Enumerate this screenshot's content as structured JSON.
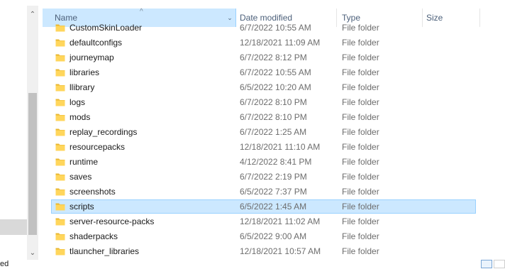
{
  "columns": {
    "name": "Name",
    "date_modified": "Date modified",
    "type": "Type",
    "size": "Size",
    "sort_indicator": "^",
    "name_dropdown": "⌄"
  },
  "nav": {
    "partial_text": "ed"
  },
  "scrollbar": {
    "up": "⌃",
    "down": "⌄"
  },
  "files": [
    {
      "name": "CustomSkinLoader",
      "date": "6/7/2022 10:55 AM",
      "type": "File folder"
    },
    {
      "name": "defaultconfigs",
      "date": "12/18/2021 11:09 AM",
      "type": "File folder"
    },
    {
      "name": "journeymap",
      "date": "6/7/2022 8:12 PM",
      "type": "File folder"
    },
    {
      "name": "libraries",
      "date": "6/7/2022 10:55 AM",
      "type": "File folder"
    },
    {
      "name": "llibrary",
      "date": "6/5/2022 10:20 AM",
      "type": "File folder"
    },
    {
      "name": "logs",
      "date": "6/7/2022 8:10 PM",
      "type": "File folder"
    },
    {
      "name": "mods",
      "date": "6/7/2022 8:10 PM",
      "type": "File folder"
    },
    {
      "name": "replay_recordings",
      "date": "6/7/2022 1:25 AM",
      "type": "File folder"
    },
    {
      "name": "resourcepacks",
      "date": "12/18/2021 11:10 AM",
      "type": "File folder"
    },
    {
      "name": "runtime",
      "date": "4/12/2022 8:41 PM",
      "type": "File folder"
    },
    {
      "name": "saves",
      "date": "6/7/2022 2:19 PM",
      "type": "File folder"
    },
    {
      "name": "screenshots",
      "date": "6/5/2022 7:37 PM",
      "type": "File folder"
    },
    {
      "name": "scripts",
      "date": "6/5/2022 1:45 AM",
      "type": "File folder",
      "selected": true
    },
    {
      "name": "server-resource-packs",
      "date": "12/18/2021 11:02 AM",
      "type": "File folder"
    },
    {
      "name": "shaderpacks",
      "date": "6/5/2022 9:00 AM",
      "type": "File folder"
    },
    {
      "name": "tlauncher_libraries",
      "date": "12/18/2021 10:57 AM",
      "type": "File folder"
    }
  ],
  "colors": {
    "selection_bg": "#cce8ff",
    "selection_border": "#99d1ff",
    "folder_yellow": "#ffd65c",
    "folder_dark": "#e8b730"
  },
  "icons": {
    "folder": "folder-icon",
    "details_view": "details-view-icon",
    "tiles_view": "tiles-view-icon"
  }
}
